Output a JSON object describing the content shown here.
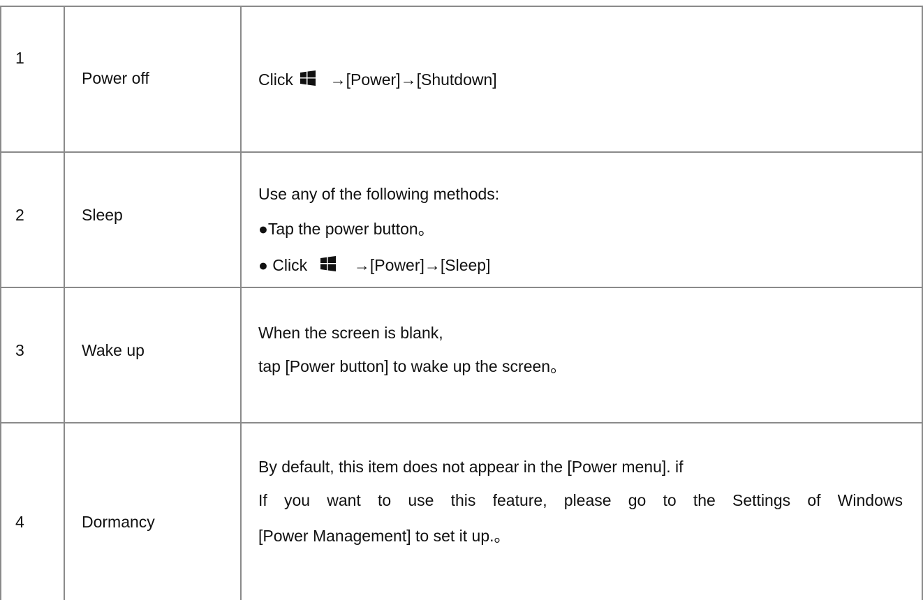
{
  "rows": [
    {
      "number": "1",
      "name": "Power off",
      "desc": {
        "prefix": "Click",
        "path": "→[Power]→[Shutdown]"
      }
    },
    {
      "number": "2",
      "name": "Sleep",
      "desc": {
        "line1": "Use any of the following methods:",
        "line2": "●Tap the power button。",
        "line3_prefix": "● Click",
        "line3_path": "→[Power]→[Sleep]"
      }
    },
    {
      "number": "3",
      "name": "Wake up",
      "desc": {
        "line1": "When the screen is blank,",
        "line2": "tap [Power button] to wake up the screen。"
      }
    },
    {
      "number": "4",
      "name": "Dormancy",
      "desc": {
        "line1": "By default, this item does not appear in the [Power menu]. if",
        "line2": "If you want to use this feature, please go to the Settings of Windows",
        "line3": "[Power Management] to set it up.。"
      }
    }
  ],
  "icons": {
    "windows_logo": "windows-logo-icon",
    "icon_color": "#111111"
  },
  "colors": {
    "grid_line": "#8a8a8a",
    "text": "#111111",
    "background": "#ffffff"
  }
}
